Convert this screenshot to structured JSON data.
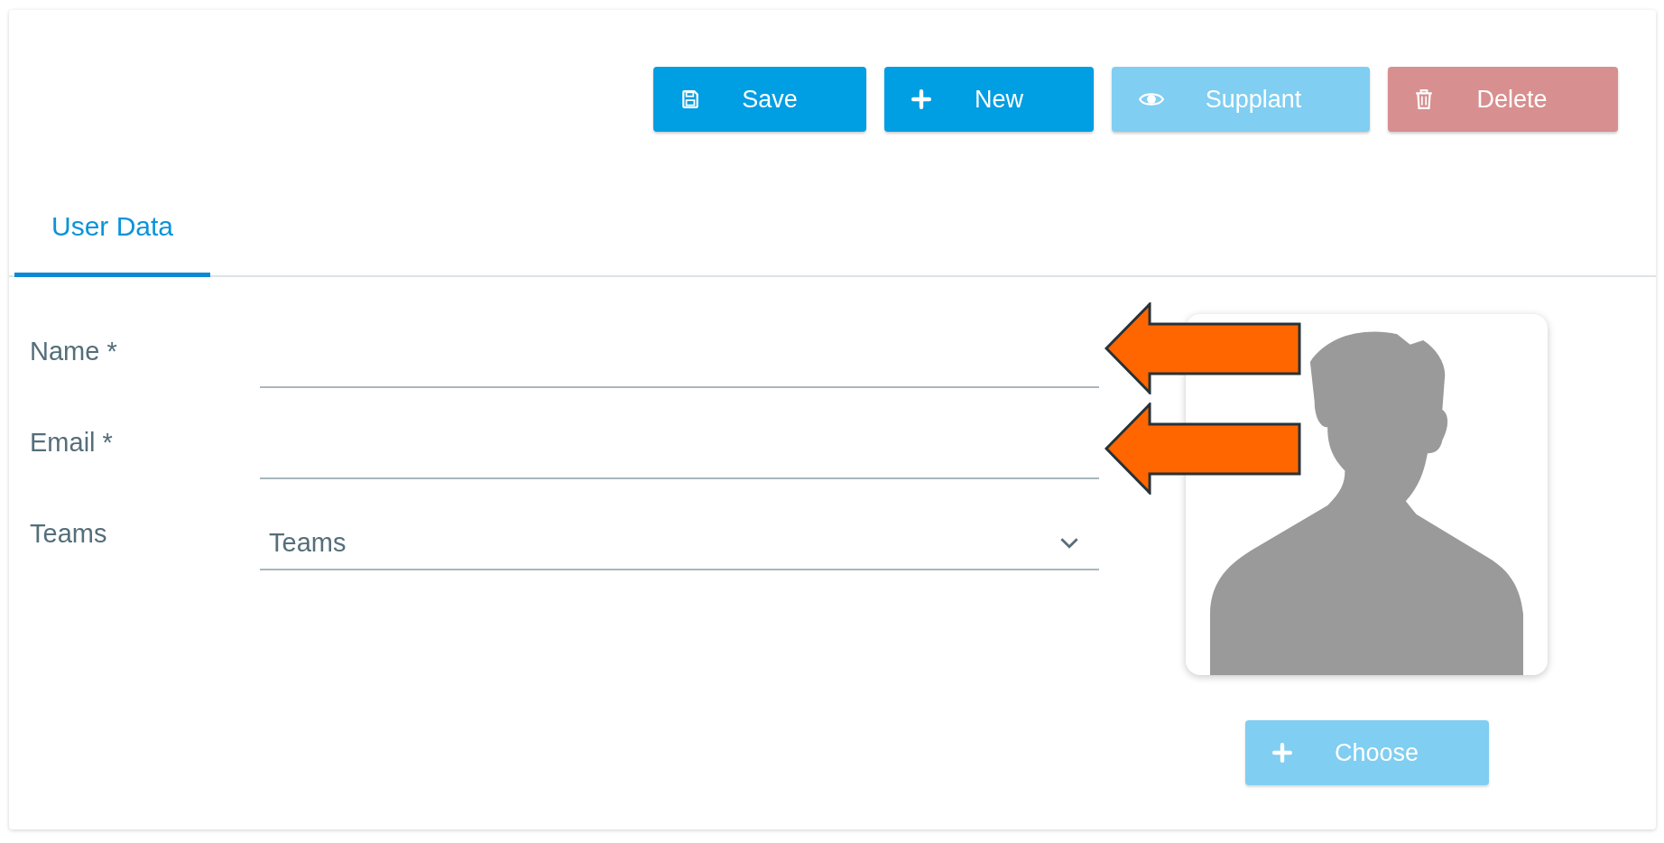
{
  "toolbar": [
    {
      "label": "Save",
      "kind": "primary",
      "disabled": false
    },
    {
      "label": "New",
      "kind": "primary",
      "disabled": false
    },
    {
      "label": "Supplant",
      "kind": "primary",
      "disabled": true
    },
    {
      "label": "Delete",
      "kind": "danger",
      "disabled": true
    }
  ],
  "tabs": [
    {
      "label": "User Data",
      "selected": true
    }
  ],
  "fields": [
    {
      "label": "Name *",
      "kind": "text"
    },
    {
      "label": "Email *",
      "kind": "text"
    },
    {
      "label": "Teams",
      "kind": "select",
      "placeholder": "Teams"
    }
  ],
  "avatar": {
    "button": {
      "label": "Choose",
      "disabled": true
    }
  }
}
